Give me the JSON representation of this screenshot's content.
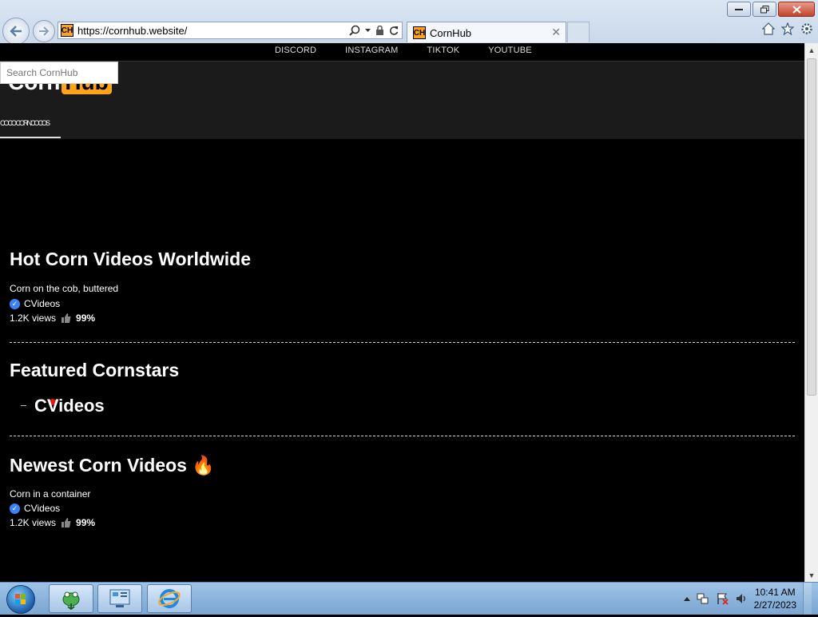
{
  "browser": {
    "url": "https://cornhub.website/",
    "tab_title": "CornHub",
    "favicon_text": "CH"
  },
  "page": {
    "nav_links": [
      "DISCORD",
      "INSTAGRAM",
      "TIKTOK",
      "YOUTUBE"
    ],
    "search_placeholder": "Search CornHub",
    "logo_corn": "Corn",
    "logo_hub": "Hub",
    "category_strip": "COCO CORNCOCOS",
    "sections": {
      "hot": {
        "heading": "Hot Corn Videos Worldwide",
        "video_title": "Corn on the cob, buttered",
        "channel": "CVideos",
        "views": "1.2K views",
        "rating": "99%"
      },
      "featured": {
        "heading": "Featured Cornstars",
        "cornstar": "CVideos"
      },
      "newest": {
        "heading": "Newest Corn Videos",
        "emoji": "🔥",
        "video_title": "Corn in a container",
        "channel": "CVideos",
        "views": "1.2K views",
        "rating": "99%"
      }
    }
  },
  "taskbar": {
    "time": "10:41 AM",
    "date": "2/27/2023"
  },
  "icons": [
    "back-icon",
    "forward-icon",
    "search-icon",
    "lock-icon",
    "refresh-icon",
    "home-icon",
    "favorites-icon",
    "settings-icon",
    "verified-icon",
    "thumbs-up-icon",
    "flag-icon",
    "volume-icon",
    "network-icon"
  ]
}
